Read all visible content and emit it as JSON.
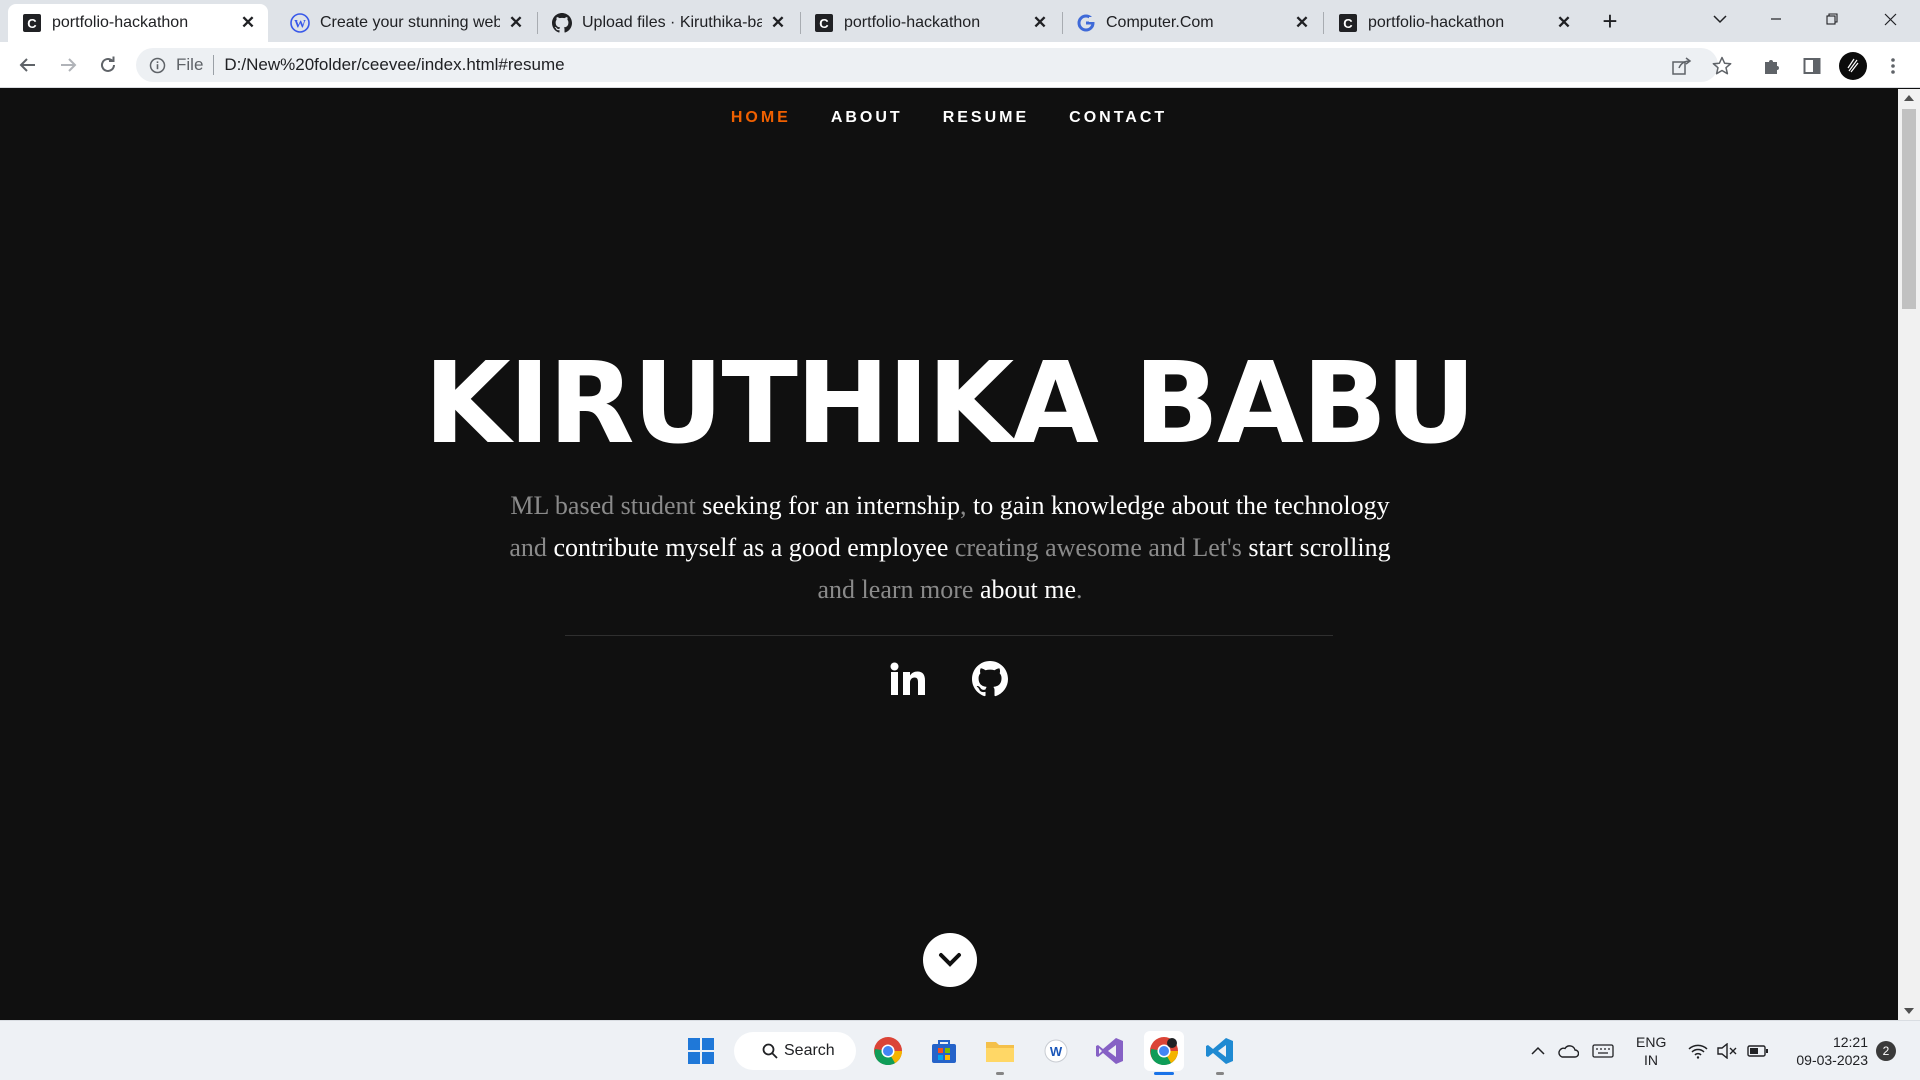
{
  "browser": {
    "tabs": [
      {
        "title": "portfolio-hackathon",
        "favicon": "c-letter-icon",
        "active": true
      },
      {
        "title": "Create your stunning websi",
        "favicon": "wordpress-icon",
        "active": false
      },
      {
        "title": "Upload files · Kiruthika-bab",
        "favicon": "github-icon",
        "active": false
      },
      {
        "title": "portfolio-hackathon",
        "favicon": "c-letter-icon",
        "active": false
      },
      {
        "title": "Computer.Com",
        "favicon": "g-letter-icon",
        "active": false
      },
      {
        "title": "portfolio-hackathon",
        "favicon": "c-letter-icon",
        "active": false
      }
    ],
    "close_glyph": "✕",
    "new_tab_glyph": "+",
    "address": {
      "scheme_label": "File",
      "url": "D:/New%20folder/ceevee/index.html#resume"
    }
  },
  "site": {
    "nav": [
      {
        "label": "Home",
        "current": true
      },
      {
        "label": "About",
        "current": false
      },
      {
        "label": "Resume",
        "current": false
      },
      {
        "label": "Contact",
        "current": false
      }
    ],
    "name": "KIRUTHIKA BABU",
    "intro": [
      {
        "text": "ML based student ",
        "emph": false
      },
      {
        "text": "seeking for an internship",
        "emph": true
      },
      {
        "text": ", ",
        "emph": false
      },
      {
        "text": "to gain knowledge about the technology",
        "emph": true
      },
      {
        "text": " and ",
        "emph": false
      },
      {
        "text": "contribute myself as a good employee",
        "emph": true
      },
      {
        "text": " creating awesome and Let's ",
        "emph": false
      },
      {
        "text": "start scrolling",
        "emph": true
      },
      {
        "text": " and learn more ",
        "emph": false
      },
      {
        "text": "about me",
        "emph": true
      },
      {
        "text": ".",
        "emph": false
      }
    ],
    "social": [
      "linkedin-icon",
      "github-icon"
    ],
    "accent": "#f06000"
  },
  "taskbar": {
    "search_label": "Search",
    "lang_line1": "ENG",
    "lang_line2": "IN",
    "time": "12:21",
    "date": "09-03-2023",
    "notification_count": "2"
  }
}
